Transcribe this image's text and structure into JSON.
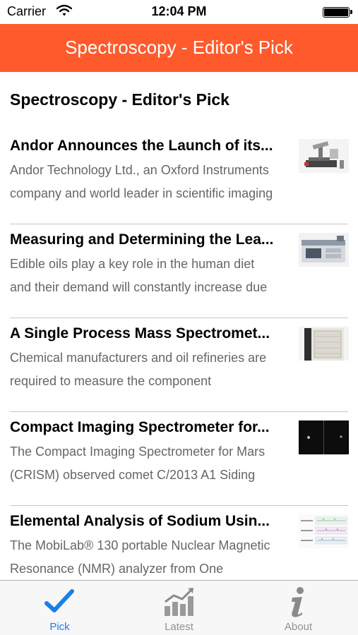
{
  "status_bar": {
    "carrier": "Carrier",
    "time": "12:04 PM"
  },
  "nav": {
    "title": "Spectroscopy - Editor's Pick"
  },
  "section": {
    "heading": "Spectroscopy - Editor's Pick"
  },
  "articles": [
    {
      "title": "Andor Announces the Launch of its...",
      "desc_line1": "Andor Technology Ltd., an Oxford Instruments",
      "desc_line2": "company and world leader in scientific imaging",
      "thumb_icon": "microscope-thumbnail"
    },
    {
      "title": "Measuring and Determining the Lea...",
      "desc_line1": "Edible oils play a key role in the human diet",
      "desc_line2": "and their demand will constantly increase due",
      "thumb_icon": "spectrometer-instrument-thumbnail"
    },
    {
      "title": "A Single Process Mass Spectromet...",
      "desc_line1": "Chemical manufacturers and oil refineries are",
      "desc_line2": "required to measure the component",
      "thumb_icon": "mass-spectrometer-cabinet-thumbnail"
    },
    {
      "title": "Compact Imaging Spectrometer for...",
      "desc_line1": "The Compact Imaging Spectrometer for Mars",
      "desc_line2": "(CRISM) observed comet C/2013 A1 Siding",
      "thumb_icon": "comet-images-thumbnail"
    },
    {
      "title": "Elemental Analysis of Sodium Usin...",
      "desc_line1": "The MobiLab® 130 portable Nuclear Magnetic",
      "desc_line2": "Resonance (NMR) analyzer from One",
      "thumb_icon": "nmr-spectra-thumbnail"
    }
  ],
  "tabs": [
    {
      "label": "Pick",
      "icon": "checkmark-icon",
      "active": true
    },
    {
      "label": "Latest",
      "icon": "bar-chart-trend-icon",
      "active": false
    },
    {
      "label": "About",
      "icon": "info-icon",
      "active": false
    }
  ],
  "colors": {
    "nav": "#ff5a2c",
    "tab_active": "#1a7fe6",
    "tab_inactive": "#929292"
  }
}
